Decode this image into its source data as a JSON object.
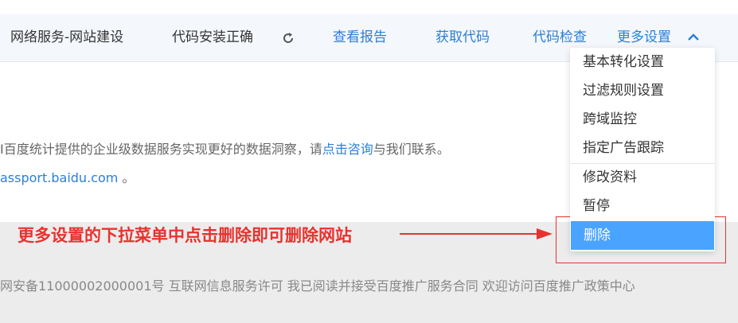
{
  "header": {
    "site_name": "网络服务-网站建设",
    "status": "代码安装正确",
    "links": {
      "report": "查看报告",
      "get_code": "获取代码",
      "check_code": "代码检查",
      "more_settings": "更多设置"
    }
  },
  "main": {
    "line1_prefix": "I百度统计提供的企业级数据服务实现更好的数据洞察，请",
    "line1_link": "点击咨询",
    "line1_suffix": "与我们联系。",
    "line2_link": "assport.baidu.com",
    "line2_suffix": " 。"
  },
  "dropdown": {
    "items": [
      {
        "label": "基本转化设置"
      },
      {
        "label": "过滤规则设置"
      },
      {
        "label": "跨域监控"
      },
      {
        "label": "指定广告跟踪"
      },
      {
        "label": "修改资料"
      },
      {
        "label": "暂停"
      },
      {
        "label": "删除"
      }
    ],
    "active_item": "删除"
  },
  "annotation": {
    "text": "更多设置的下拉菜单中点击删除即可删除网站"
  },
  "footer": {
    "text": "网安备11000002000001号 互联网信息服务许可 我已阅读并接受百度推广服务合同 欢迎访问百度推广政策中心"
  },
  "colors": {
    "link": "#2a7fd8",
    "active_menu_bg": "#4aa3ff",
    "annotation": "#e8322f"
  }
}
